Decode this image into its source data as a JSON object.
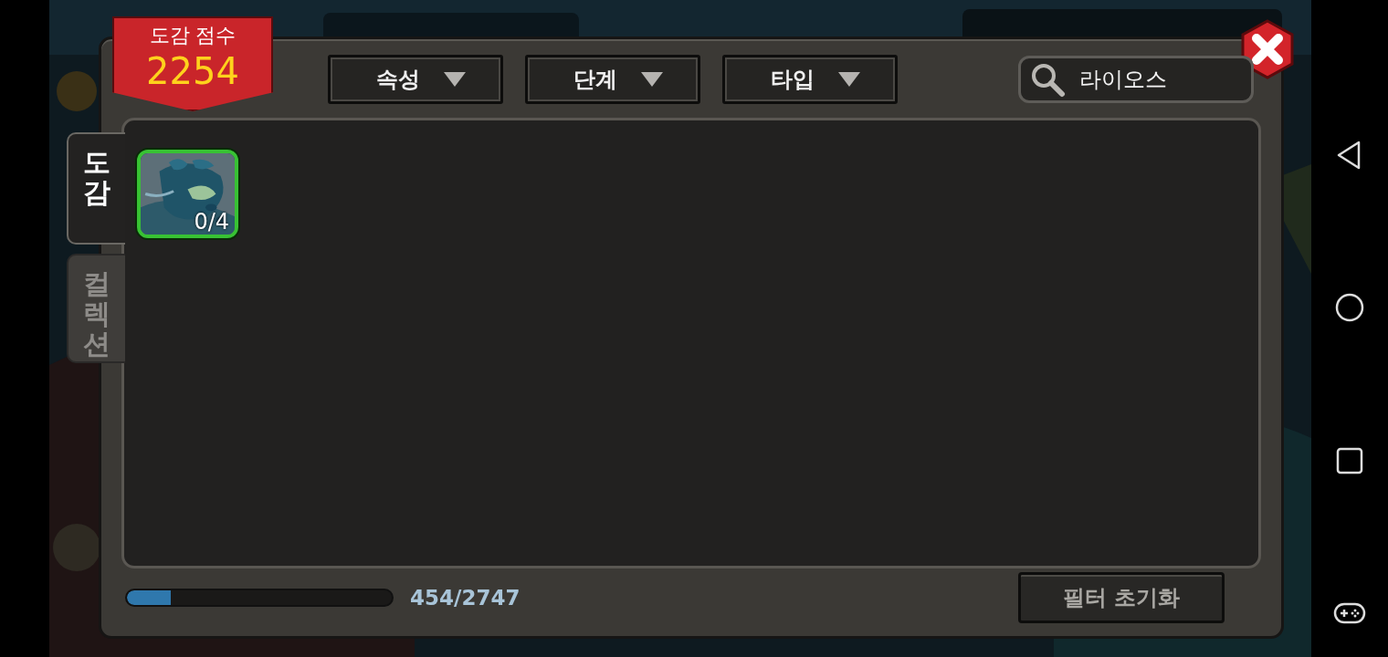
{
  "score_banner": {
    "label": "도감 점수",
    "value": "2254"
  },
  "filters": [
    {
      "label": "속성"
    },
    {
      "label": "단계"
    },
    {
      "label": "타입"
    }
  ],
  "search": {
    "value": "라이오스"
  },
  "tabs": [
    {
      "label": "도감",
      "selected": true
    },
    {
      "label": "컬렉션",
      "selected": false
    }
  ],
  "cards": [
    {
      "kind": "picture",
      "count": "0/4"
    }
  ],
  "progress": {
    "level": 0.165,
    "reading": "454/2747"
  },
  "reset_button": {
    "label": "필터 초기화"
  }
}
